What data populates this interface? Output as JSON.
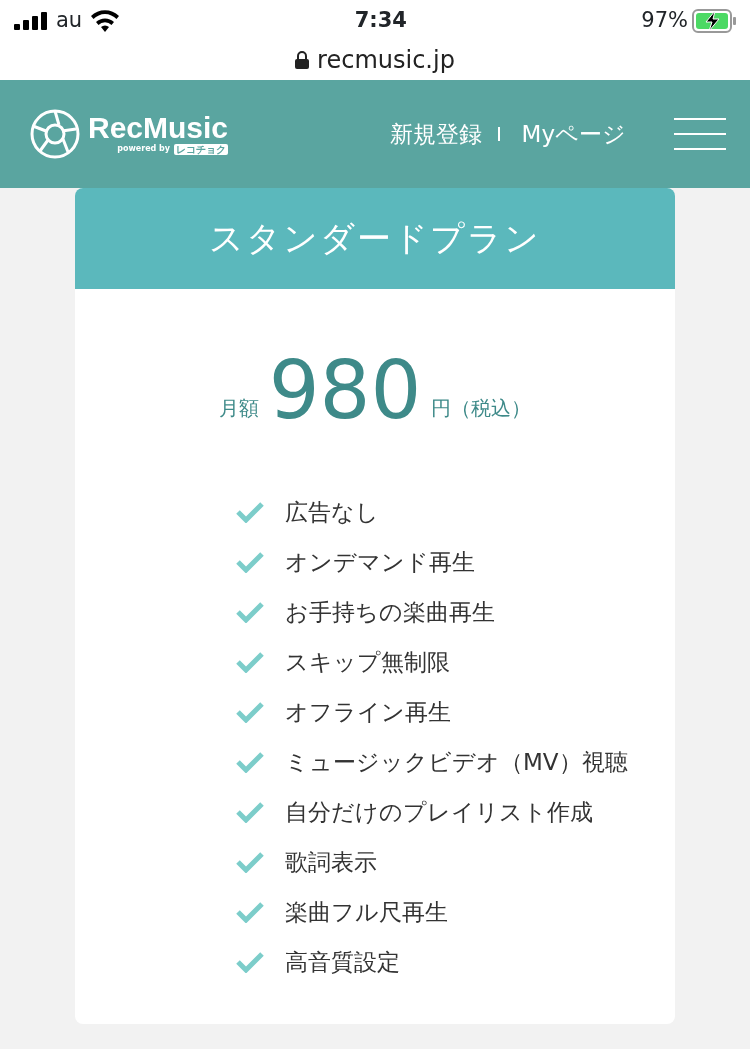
{
  "status_bar": {
    "carrier": "au",
    "time": "7:34",
    "battery": "97%",
    "url": "recmusic.jp"
  },
  "header": {
    "logo": "RecMusic",
    "powered_by": "powered by",
    "partner": "レコチョク",
    "links": [
      "新規登録",
      "Myページ"
    ]
  },
  "plan": {
    "title": "スタンダードプラン",
    "price_prefix": "月額",
    "price": "980",
    "price_suffix": "円（税込）",
    "features": [
      "広告なし",
      "オンデマンド再生",
      "お手持ちの楽曲再生",
      "スキップ無制限",
      "オフライン再生",
      "ミュージックビデオ（MV）視聴",
      "自分だけのプレイリスト作成",
      "歌詞表示",
      "楽曲フル尺再生",
      "高音質設定"
    ]
  }
}
